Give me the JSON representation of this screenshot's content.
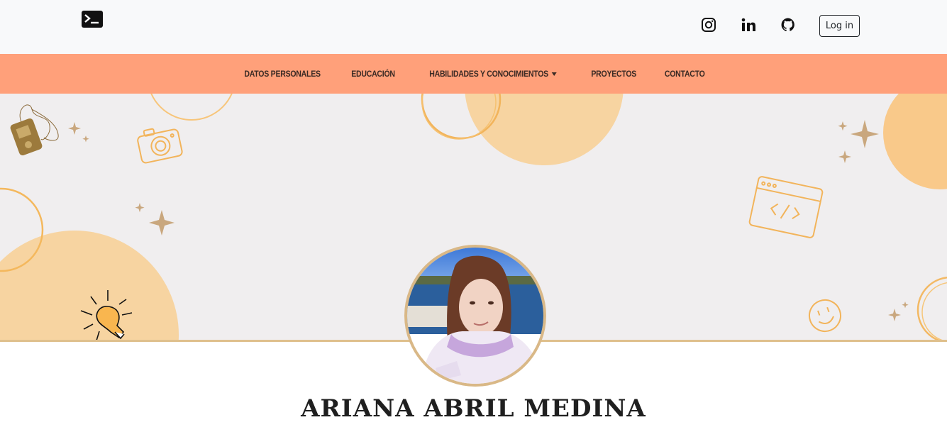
{
  "topbar": {
    "logo_icon": "terminal-icon",
    "social": [
      {
        "name": "instagram-icon"
      },
      {
        "name": "linkedin-icon"
      },
      {
        "name": "github-icon"
      }
    ],
    "login_label": "Log in"
  },
  "nav": {
    "items": [
      {
        "label": "DATOS PERSONALES"
      },
      {
        "label": "EDUCACIÓN"
      },
      {
        "label": "HABILIDADES Y CONOCIMIENTOS"
      },
      {
        "label": "PROYECTOS"
      },
      {
        "label": "CONTACTO"
      }
    ]
  },
  "profile": {
    "name": "ARIANA ABRIL MEDINA"
  },
  "colors": {
    "nav_bg": "#ffa07a",
    "hero_bg": "#f0eeef",
    "accent_circle": "#f7d4a1",
    "accent_line": "#dfc08d"
  }
}
